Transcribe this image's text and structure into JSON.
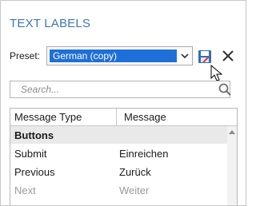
{
  "panel": {
    "title": "TEXT LABELS"
  },
  "preset": {
    "label": "Preset:",
    "selected_value": "German (copy)",
    "dropdown_icon": "chevron-down-icon"
  },
  "toolbar": {
    "save_icon": "save-icon",
    "close_icon": "close-icon"
  },
  "search": {
    "placeholder": "Search...",
    "icon": "search-icon"
  },
  "table": {
    "columns": [
      "Message Type",
      "Message"
    ],
    "group": "Buttons",
    "rows": [
      {
        "type": "Submit",
        "message": "Einreichen",
        "disabled": false
      },
      {
        "type": "Previous",
        "message": "Zurück",
        "disabled": false
      },
      {
        "type": "Next",
        "message": "Weiter",
        "disabled": true
      }
    ]
  },
  "colors": {
    "title": "#3b78b3",
    "selection": "#1e6fd9",
    "group_row": "#e9e9e9",
    "close_icon": "#333333"
  }
}
